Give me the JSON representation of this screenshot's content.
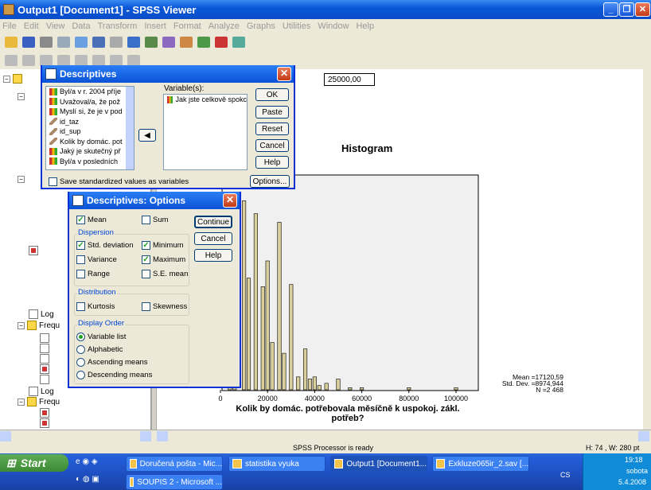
{
  "window": {
    "title": "Output1 [Document1] - SPSS Viewer"
  },
  "menu": [
    "File",
    "Edit",
    "View",
    "Data",
    "Transform",
    "Insert",
    "Format",
    "Analyze",
    "Graphs",
    "Utilities",
    "Window",
    "Help"
  ],
  "tree": {
    "labels": [
      "Log",
      "Frequ",
      "Log",
      "Frequ"
    ]
  },
  "output": {
    "cell_value": "25000,00",
    "chart_title": "Histogram",
    "stats": {
      "mean": "Mean =17120,59",
      "sd": "Std. Dev. =8974,944",
      "n": "N =2 468"
    },
    "xlabel_line1": "Kolik by domác. potřebovala měsíčně k uspokoj. zákl.",
    "xlabel_line2": "potřeb?"
  },
  "chart_data": {
    "type": "bar",
    "x_ticks": [
      "0",
      "20000",
      "40000",
      "60000",
      "80000",
      "100000"
    ],
    "xlim": [
      0,
      100000
    ],
    "bins_visible": [
      {
        "x": 4000,
        "value": 0.36
      },
      {
        "x": 6000,
        "value": 0.21
      },
      {
        "x": 10000,
        "value": 0.88
      },
      {
        "x": 12000,
        "value": 0.52
      },
      {
        "x": 15000,
        "value": 0.82
      },
      {
        "x": 18000,
        "value": 0.48
      },
      {
        "x": 20000,
        "value": 0.6
      },
      {
        "x": 22000,
        "value": 0.22
      },
      {
        "x": 25000,
        "value": 0.78
      },
      {
        "x": 27000,
        "value": 0.17
      },
      {
        "x": 30000,
        "value": 0.49
      },
      {
        "x": 33000,
        "value": 0.06
      },
      {
        "x": 36000,
        "value": 0.19
      },
      {
        "x": 38000,
        "value": 0.05
      },
      {
        "x": 40000,
        "value": 0.06
      },
      {
        "x": 42000,
        "value": 0.02
      },
      {
        "x": 45000,
        "value": 0.03
      },
      {
        "x": 50000,
        "value": 0.05
      },
      {
        "x": 55000,
        "value": 0.01
      },
      {
        "x": 60000,
        "value": 0.01
      },
      {
        "x": 80000,
        "value": 0.01
      },
      {
        "x": 100000,
        "value": 0.01
      }
    ]
  },
  "descriptives": {
    "title": "Descriptives",
    "variables_label": "Variable(s):",
    "source_items": [
      "Byl/a v r. 2004 příje",
      "Uvažoval/a, že pož",
      "Myslí si, že je v pod",
      "id_taz",
      "id_sup",
      "Kolik by domác. pot",
      "Jaký je skutečný př",
      "Byl/a v posledních"
    ],
    "target_items": [
      "Jak jste celkově spokc"
    ],
    "buttons": {
      "ok": "OK",
      "paste": "Paste",
      "reset": "Reset",
      "cancel": "Cancel",
      "help": "Help",
      "options": "Options..."
    },
    "save_label": "Save standardized values as variables"
  },
  "options": {
    "title": "Descriptives: Options",
    "mean": "Mean",
    "sum": "Sum",
    "dispersion": "Dispersion",
    "std": "Std. deviation",
    "minimum": "Minimum",
    "variance": "Variance",
    "maximum": "Maximum",
    "range": "Range",
    "se_mean": "S.E. mean",
    "distribution": "Distribution",
    "kurtosis": "Kurtosis",
    "skewness": "Skewness",
    "display_order": "Display Order",
    "orders": [
      "Variable list",
      "Alphabetic",
      "Ascending means",
      "Descending means"
    ],
    "buttons": {
      "continue": "Continue",
      "cancel": "Cancel",
      "help": "Help"
    }
  },
  "status": {
    "processor": "SPSS Processor is ready",
    "position": "H: 74 , W: 280 pt"
  },
  "taskbar": {
    "start": "Start",
    "tasks": [
      "Doručená pošta - Mic...",
      "statistika vyuka",
      "Output1 [Document1...",
      "Exkluze065ir_2.sav [...",
      "SOUPIS 2 - Microsoft ..."
    ],
    "lang": "CS",
    "time": "19:18",
    "day": "sobota",
    "date": "5.4.2008"
  }
}
